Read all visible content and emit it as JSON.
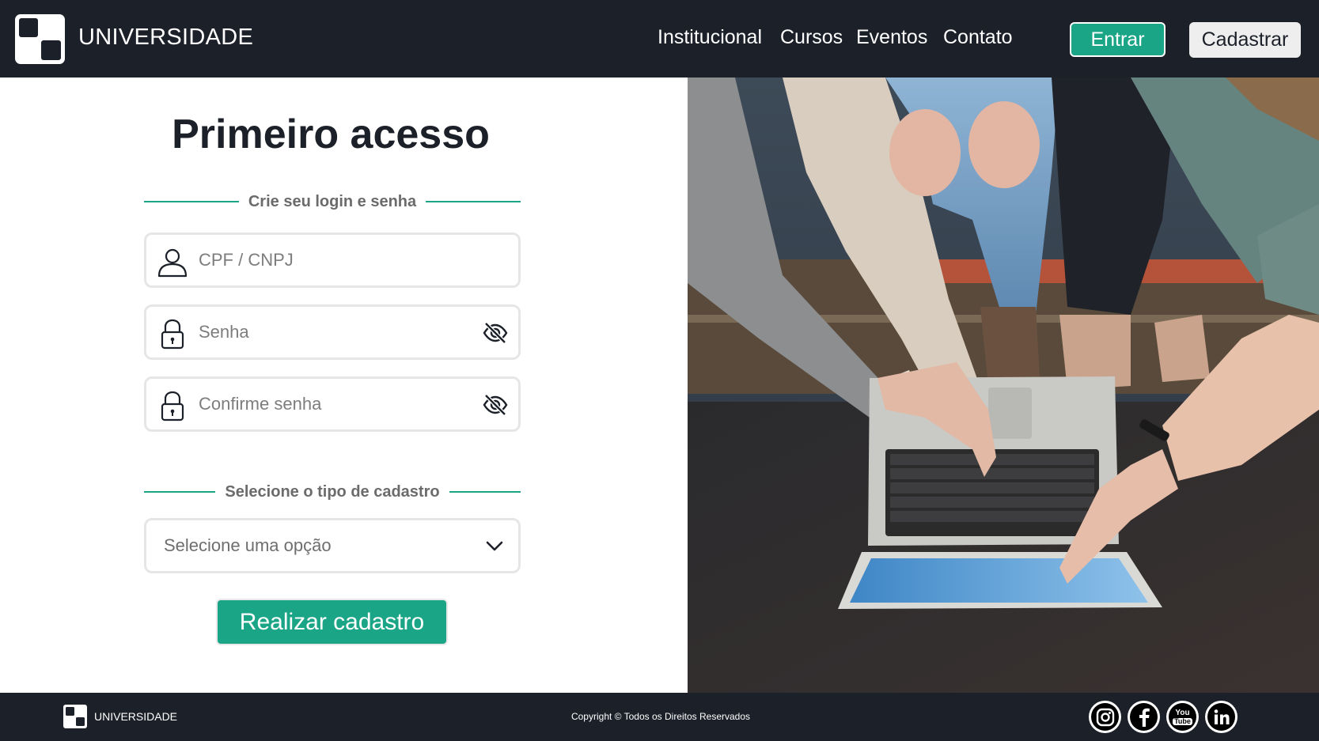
{
  "header": {
    "brand": "UNIVERSIDADE",
    "nav": [
      "Institucional",
      "Cursos",
      "Eventos",
      "Contato"
    ],
    "login_label": "Entrar",
    "signup_label": "Cadastrar"
  },
  "form": {
    "title": "Primeiro acesso",
    "section_login": "Crie seu login e senha",
    "fields": {
      "document_placeholder": "CPF / CNPJ",
      "password_placeholder": "Senha",
      "confirm_placeholder": "Confirme senha"
    },
    "section_type": "Selecione o tipo de cadastro",
    "select_value": "Selecione uma opção",
    "submit_label": "Realizar cadastro"
  },
  "footer": {
    "brand": "UNIVERSIDADE",
    "copyright": "Copyright ©  Todos os Direitos Reservados",
    "social": [
      "instagram-icon",
      "facebook-icon",
      "youtube-icon",
      "linkedin-icon"
    ],
    "youtube_you": "You",
    "youtube_tube": "Tube"
  },
  "colors": {
    "header_bg": "#1c2029",
    "accent": "#1aa587",
    "secondary_button": "#eeeeee"
  }
}
